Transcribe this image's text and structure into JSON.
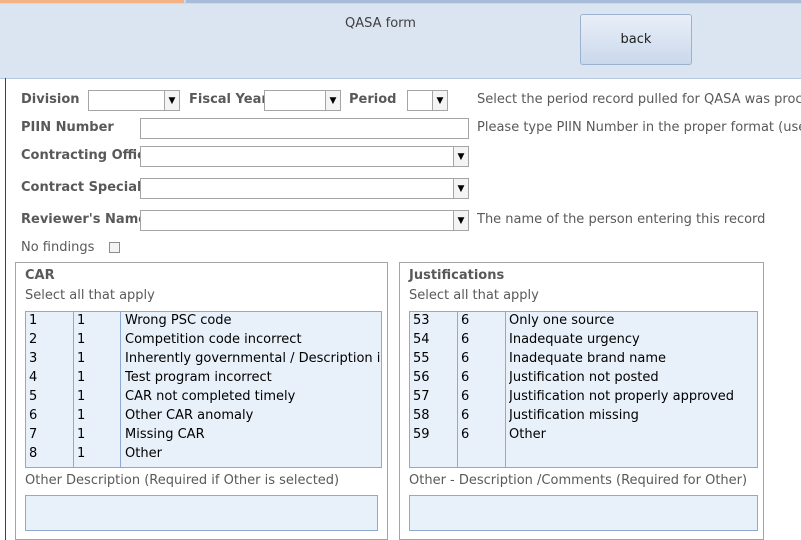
{
  "header": {
    "title": "QASA form",
    "back_label": "back"
  },
  "fields": {
    "division_label": "Division",
    "fiscal_year_label": "Fiscal Year",
    "period_label": "Period",
    "period_hint": "Select the period  record  pulled for QASA was processed",
    "piin_label": "PIIN Number",
    "piin_hint": "Please type PIIN  Number in the proper format (use dashes)",
    "co_label": "Contracting Officer",
    "cs_label": "Contract Specialist",
    "reviewer_label": "Reviewer's Name",
    "reviewer_hint": "The name of the person entering this record",
    "no_findings_label": "No findings"
  },
  "car": {
    "title": "CAR",
    "subtitle": "Select all that apply",
    "rows": [
      {
        "id": "1",
        "cat": "1",
        "desc": "Wrong PSC code"
      },
      {
        "id": "2",
        "cat": "1",
        "desc": "Competition code incorrect"
      },
      {
        "id": "3",
        "cat": "1",
        "desc": "Inherently governmental / Description incorrect"
      },
      {
        "id": "4",
        "cat": "1",
        "desc": "Test program incorrect"
      },
      {
        "id": "5",
        "cat": "1",
        "desc": "CAR not completed timely"
      },
      {
        "id": "6",
        "cat": "1",
        "desc": "Other CAR anomaly"
      },
      {
        "id": "7",
        "cat": "1",
        "desc": "Missing CAR"
      },
      {
        "id": "8",
        "cat": "1",
        "desc": "Other"
      }
    ],
    "other_label": "Other Description (Required if Other is selected)"
  },
  "justifications": {
    "title": "Justifications",
    "subtitle": "Select all that apply",
    "rows": [
      {
        "id": "53",
        "cat": "6",
        "desc": "Only one source"
      },
      {
        "id": "54",
        "cat": "6",
        "desc": "Inadequate urgency"
      },
      {
        "id": "55",
        "cat": "6",
        "desc": "Inadequate brand name"
      },
      {
        "id": "56",
        "cat": "6",
        "desc": "Justification not posted"
      },
      {
        "id": "57",
        "cat": "6",
        "desc": "Justification not properly approved"
      },
      {
        "id": "58",
        "cat": "6",
        "desc": "Justification missing"
      },
      {
        "id": "59",
        "cat": "6",
        "desc": "Other"
      }
    ],
    "other_label": "Other - Description /Comments (Required for Other)"
  }
}
